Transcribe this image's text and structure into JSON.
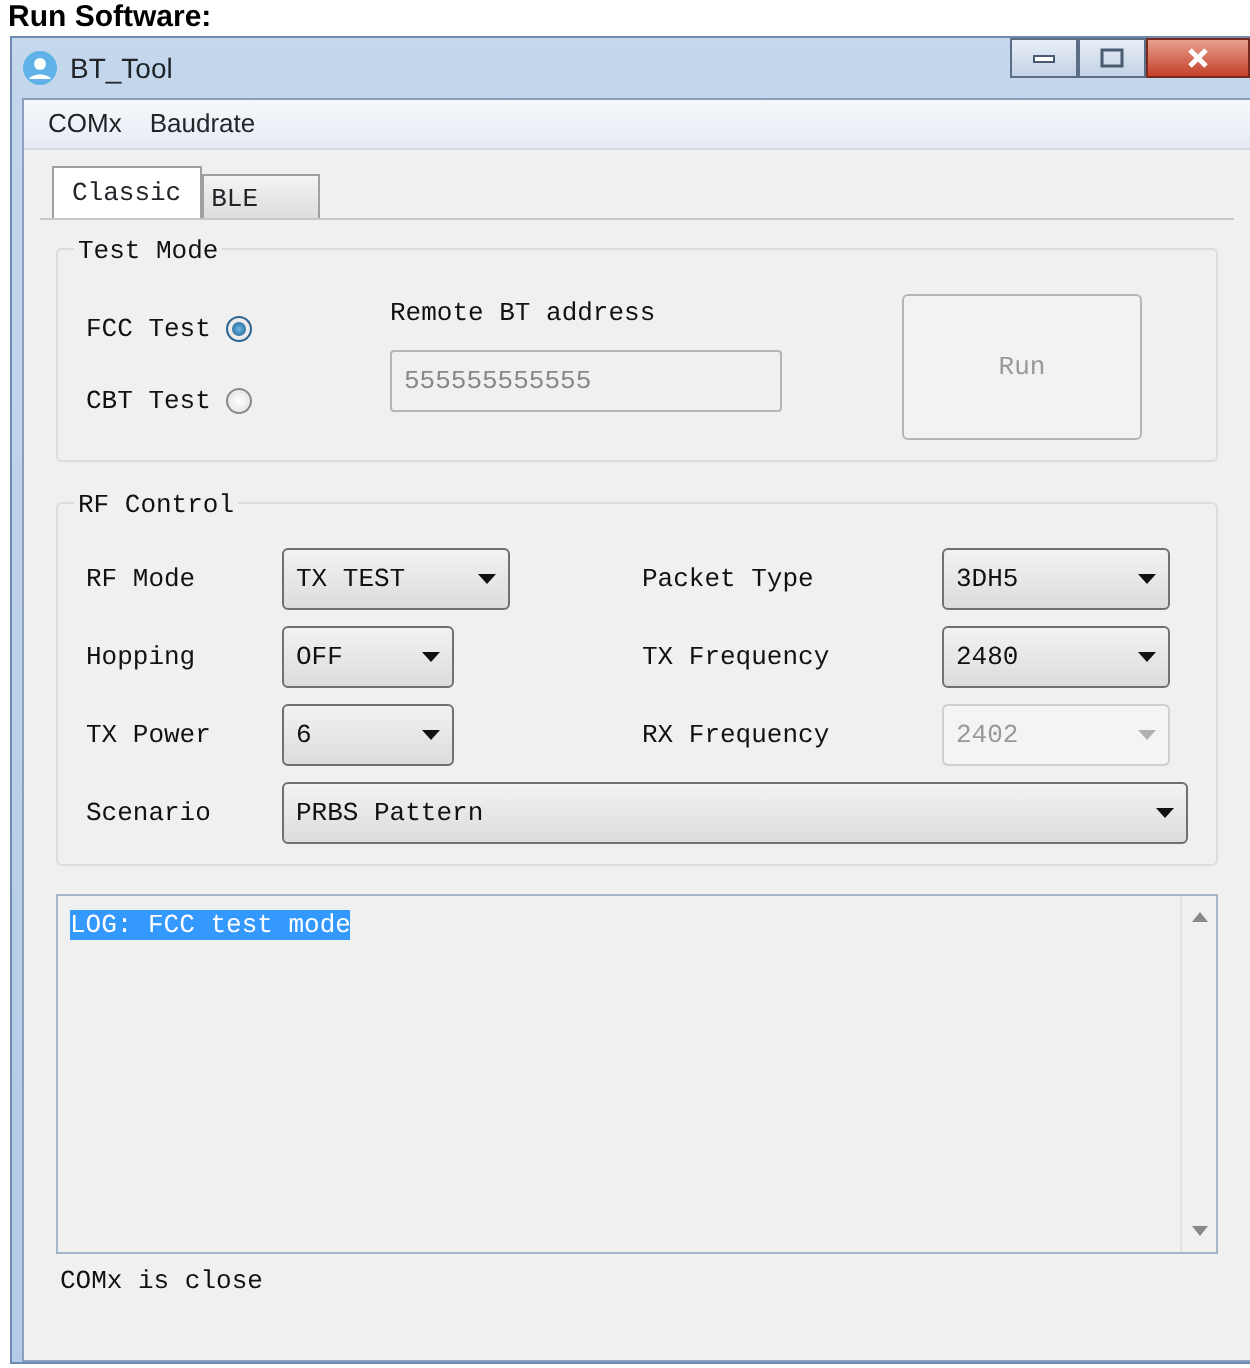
{
  "heading": "Run Software:",
  "window": {
    "title": "BT_Tool"
  },
  "menu": [
    "COMx",
    "Baudrate"
  ],
  "tabs": [
    {
      "label": "Classic",
      "selected": true
    },
    {
      "label": "BLE",
      "selected": false
    }
  ],
  "test_mode": {
    "title": "Test Mode",
    "options": [
      {
        "label": "FCC Test",
        "selected": true
      },
      {
        "label": "CBT Test",
        "selected": false
      }
    ],
    "address_label": "Remote BT address",
    "address_value": "555555555555",
    "address_disabled": true,
    "run_button": {
      "label": "Run",
      "disabled": true
    }
  },
  "rf_control": {
    "title": "RF Control",
    "left_fields": [
      {
        "label": "RF Mode",
        "value": "TX TEST",
        "disabled": false
      },
      {
        "label": "Hopping",
        "value": "OFF",
        "disabled": false
      },
      {
        "label": "TX Power",
        "value": "6",
        "disabled": false
      }
    ],
    "right_fields": [
      {
        "label": "Packet Type",
        "value": "3DH5",
        "disabled": false
      },
      {
        "label": "TX Frequency",
        "value": "2480",
        "disabled": false
      },
      {
        "label": "RX Frequency",
        "value": "2402",
        "disabled": true
      }
    ],
    "scenario": {
      "label": "Scenario",
      "value": "PRBS Pattern",
      "disabled": false
    }
  },
  "log": {
    "lines": [
      {
        "text": "LOG: FCC test mode",
        "selected": true
      }
    ]
  },
  "status_bar": "COMx is close"
}
